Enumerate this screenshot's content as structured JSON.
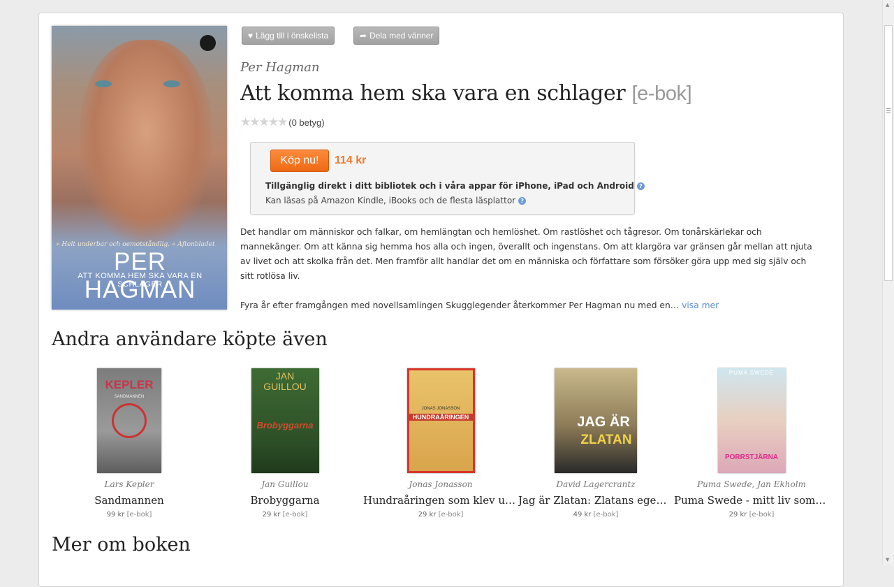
{
  "actions": {
    "wishlist_label": "Lägg till i önskelista",
    "share_label": "Dela med vänner"
  },
  "book": {
    "author": "Per Hagman",
    "title": "Att komma hem ska vara en schlager",
    "format": "[e-bok]",
    "rating_count": "(0 betyg)",
    "stars_filled": 0,
    "stars_total": 5,
    "cover": {
      "quote": "» Helt underbar och oemotståndlig. « Aftonbladet",
      "author_text": "PER HAGMAN",
      "subtitle_text": "ATT KOMMA HEM SKA VARA EN SCHLAGER"
    }
  },
  "purchase": {
    "buy_label": "Köp nu!",
    "price": "114 kr",
    "availability_1": "Tillgänglig direkt i ditt bibliotek och i våra appar för iPhone, iPad och Android",
    "availability_2": "Kan läsas på Amazon Kindle, iBooks och de flesta läsplattor"
  },
  "description": {
    "paragraph_1": "Det handlar om människor och falkar, om hemlängtan och hemlöshet. Om rastlöshet och tågresor. Om tonårskärlekar och mannekänger. Om att känna sig hemma hos alla och ingen, överallt och ingenstans. Om att klargöra var gränsen går mellan att njuta av livet och att skolka från det. Men framför allt handlar det om en människa och författare som försöker göra upp med sig själv och sitt rotlösa liv.",
    "paragraph_2": "Fyra år efter framgången med novellsamlingen Skugglegender återkommer Per Hagman nu med en…",
    "show_more": "visa mer"
  },
  "recommendations": {
    "heading": "Andra användare köpte även",
    "items": [
      {
        "author": "Lars Kepler",
        "title": "Sandmannen",
        "price": "99 kr",
        "format": "[e-bok]",
        "cover_top": "KEPLER",
        "cover_sub": "SANDMANNEN"
      },
      {
        "author": "Jan Guillou",
        "title": "Brobyggarna",
        "price": "29 kr",
        "format": "[e-bok]",
        "cover_top": "JAN GUILLOU",
        "cover_sub": "Brobyggarna"
      },
      {
        "author": "Jonas Jonasson",
        "title": "Hundraåringen som klev ut g...",
        "price": "29 kr",
        "format": "[e-bok]",
        "cover_top": "JONAS JONASSON",
        "cover_sub": "HUNDRAÅRINGEN"
      },
      {
        "author": "David Lagercrantz",
        "title": "Jag är Zlatan: Zlatans egen b...",
        "price": "49 kr",
        "format": "[e-bok]",
        "cover_top": "JAG ÄR",
        "cover_sub": "ZLATAN"
      },
      {
        "author": "Puma Swede, Jan Ekholm",
        "title": "Puma Swede - mitt liv som p...",
        "price": "29 kr",
        "format": "[e-bok]",
        "cover_top": "PUMA SWEDE",
        "cover_sub": "PORRSTJÄRNA"
      }
    ]
  },
  "more_section": {
    "heading": "Mer om boken"
  },
  "colors": {
    "accent_orange": "#f07a2b",
    "link_blue": "#5b8fd6",
    "background": "#ececec"
  }
}
